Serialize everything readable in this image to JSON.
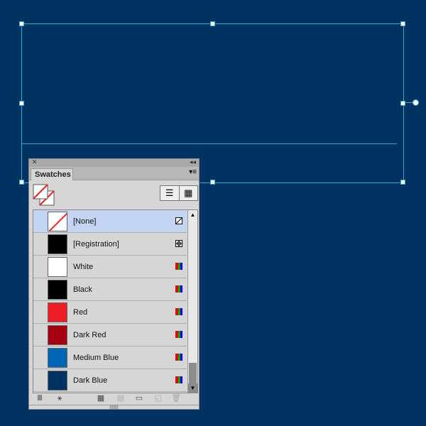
{
  "panel": {
    "title": "Swatches",
    "collapse_icon": "double-chevron-left-icon",
    "close_icon": "close-icon",
    "menu_icon": "panel-menu-icon"
  },
  "swatches": [
    {
      "name": "[None]",
      "color": "none",
      "type": "none-icon",
      "selected": true
    },
    {
      "name": "[Registration]",
      "color": "#000000",
      "type": "registration-icon"
    },
    {
      "name": "White",
      "color": "#ffffff",
      "type": "rgb-icon"
    },
    {
      "name": "Black",
      "color": "#000000",
      "type": "rgb-icon"
    },
    {
      "name": "Red",
      "color": "#ee1c24",
      "type": "rgb-icon"
    },
    {
      "name": "Dark Red",
      "color": "#a50010",
      "type": "rgb-icon"
    },
    {
      "name": "Medium Blue",
      "color": "#0065b3",
      "type": "rgb-icon"
    },
    {
      "name": "Dark Blue",
      "color": "#003262",
      "type": "rgb-icon"
    }
  ],
  "canvas": {
    "background": "#003262",
    "selection_color": "#3aa7c8"
  }
}
